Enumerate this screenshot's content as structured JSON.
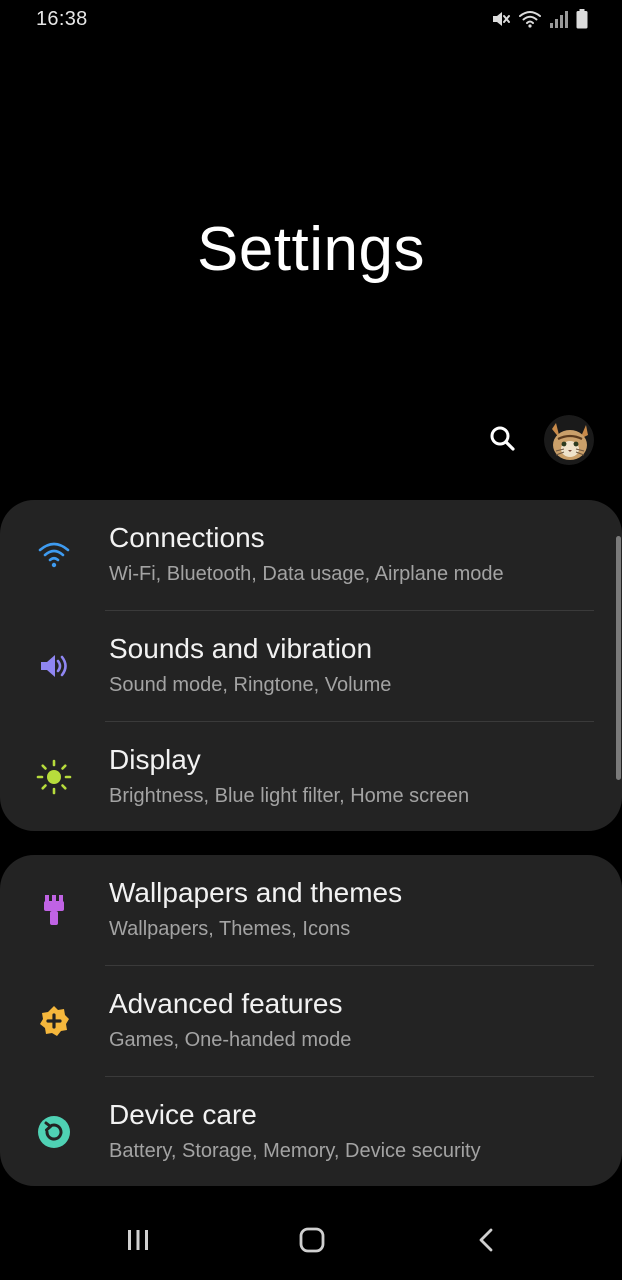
{
  "status_bar": {
    "time": "16:38",
    "icons": [
      "mute-icon",
      "wifi-icon",
      "signal-icon",
      "battery-icon"
    ]
  },
  "header": {
    "title": "Settings",
    "search_icon": "search-icon",
    "avatar": "profile-avatar"
  },
  "colors": {
    "background": "#000000",
    "card": "#232323",
    "connections_icon": "#3e9bf0",
    "sounds_icon": "#8f86f2",
    "display_icon": "#b7dc3c",
    "wallpapers_icon": "#c063e4",
    "advanced_icon": "#f5b73c",
    "device_care_icon": "#4fd1b4"
  },
  "groups": [
    {
      "items": [
        {
          "icon": "wifi-icon",
          "label": "Connections",
          "subtitle": "Wi-Fi, Bluetooth, Data usage, Airplane mode"
        },
        {
          "icon": "speaker-icon",
          "label": "Sounds and vibration",
          "subtitle": "Sound mode, Ringtone, Volume"
        },
        {
          "icon": "brightness-icon",
          "label": "Display",
          "subtitle": "Brightness, Blue light filter, Home screen"
        }
      ]
    },
    {
      "items": [
        {
          "icon": "paintbrush-icon",
          "label": "Wallpapers and themes",
          "subtitle": "Wallpapers, Themes, Icons"
        },
        {
          "icon": "gear-plus-icon",
          "label": "Advanced features",
          "subtitle": "Games, One-handed mode"
        },
        {
          "icon": "refresh-icon",
          "label": "Device care",
          "subtitle": "Battery, Storage, Memory, Device security"
        }
      ]
    }
  ],
  "nav_bar": {
    "buttons": [
      "recents-icon",
      "home-icon",
      "back-icon"
    ]
  }
}
